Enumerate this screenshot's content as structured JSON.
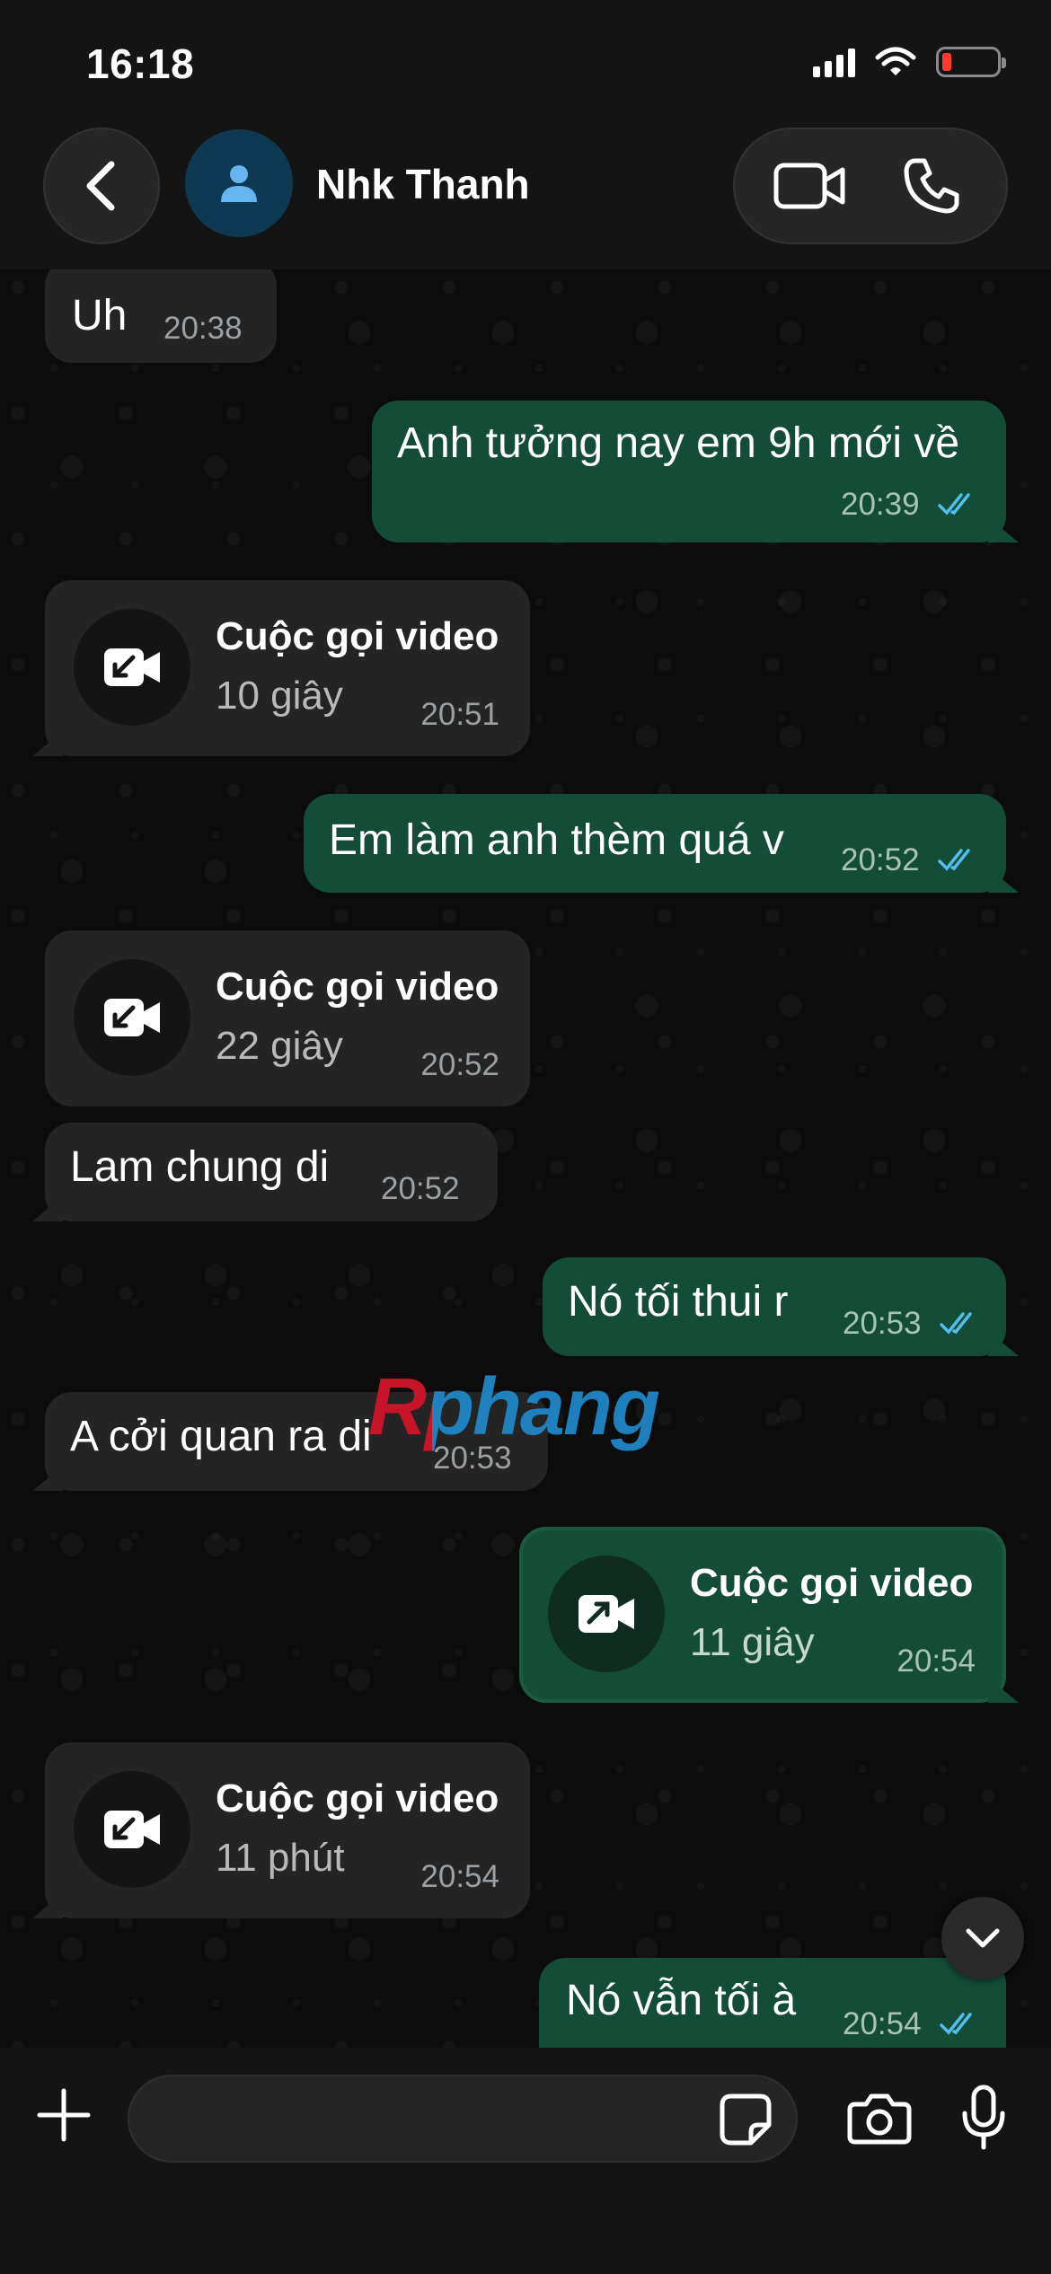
{
  "status_bar": {
    "time": "16:18"
  },
  "header": {
    "contact_name": "Nhk Thanh"
  },
  "messages": [
    {
      "direction": "in",
      "type": "text",
      "text": "Uh",
      "time": "20:38"
    },
    {
      "direction": "out",
      "type": "text",
      "text": "Anh tưởng nay em 9h mới về",
      "time": "20:39",
      "read": true
    },
    {
      "direction": "in",
      "type": "call",
      "title": "Cuộc gọi video",
      "duration": "10 giây",
      "time": "20:51"
    },
    {
      "direction": "out",
      "type": "text",
      "text": "Em làm anh thèm quá v",
      "time": "20:52",
      "read": true
    },
    {
      "direction": "in",
      "type": "call",
      "title": "Cuộc gọi video",
      "duration": "22 giây",
      "time": "20:52"
    },
    {
      "direction": "in",
      "type": "text",
      "text": "Lam chung di",
      "time": "20:52"
    },
    {
      "direction": "out",
      "type": "text",
      "text": "Nó tối thui r",
      "time": "20:53",
      "read": true
    },
    {
      "direction": "in",
      "type": "text",
      "text": "A cởi  quan ra di",
      "time": "20:53"
    },
    {
      "direction": "out",
      "type": "call",
      "title": "Cuộc gọi video",
      "duration": "11 giây",
      "time": "20:54"
    },
    {
      "direction": "in",
      "type": "call",
      "title": "Cuộc gọi video",
      "duration": "11 phút",
      "time": "20:54"
    },
    {
      "direction": "out",
      "type": "text",
      "text": "Nó vẫn tối à",
      "time": "20:54",
      "read": true
    }
  ],
  "watermark": "Rphang",
  "input": {
    "placeholder": ""
  },
  "icons": {
    "back": "chevron-left-icon",
    "avatar": "person-icon",
    "video_call": "video-camera-icon",
    "voice_call": "phone-icon",
    "call_in": "incoming-video-call-icon",
    "call_out": "outgoing-video-call-icon",
    "scroll": "chevron-down-icon",
    "attach": "plus-icon",
    "sticker": "sticker-icon",
    "camera": "camera-icon",
    "mic": "microphone-icon"
  },
  "colors": {
    "incoming_bubble": "#242424",
    "outgoing_bubble": "#144d37",
    "read_ticks": "#53bdeb",
    "battery_low": "#ff3b30"
  }
}
